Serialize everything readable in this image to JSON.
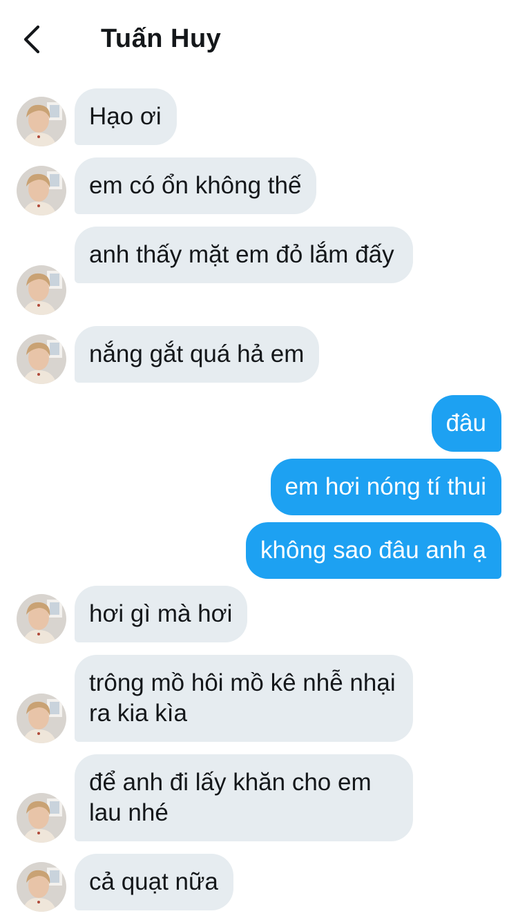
{
  "header": {
    "title": "Tuấn Huy",
    "back_icon": "chevron-left-icon"
  },
  "colors": {
    "incoming_bubble": "#e6ecf0",
    "outgoing_bubble": "#1da1f2",
    "outgoing_text": "#ffffff",
    "incoming_text": "#14171a"
  },
  "messages": [
    {
      "from": "them",
      "text": "Hạo ơi"
    },
    {
      "from": "them",
      "text": "em có ổn không thế"
    },
    {
      "from": "them",
      "text": "anh thấy mặt em đỏ lắm đấy"
    },
    {
      "from": "them",
      "text": "nắng gắt quá hả em"
    },
    {
      "from": "me",
      "text": "đâu"
    },
    {
      "from": "me",
      "text": "em hơi nóng tí thui"
    },
    {
      "from": "me",
      "text": "không sao đâu anh ạ"
    },
    {
      "from": "them",
      "text": "hơi gì mà hơi"
    },
    {
      "from": "them",
      "text": "trông mồ hôi mồ kê nhễ nhại ra kia kìa"
    },
    {
      "from": "them",
      "text": "để anh đi lấy khăn cho em lau nhé"
    },
    {
      "from": "them",
      "text": "cả quạt nữa"
    }
  ]
}
